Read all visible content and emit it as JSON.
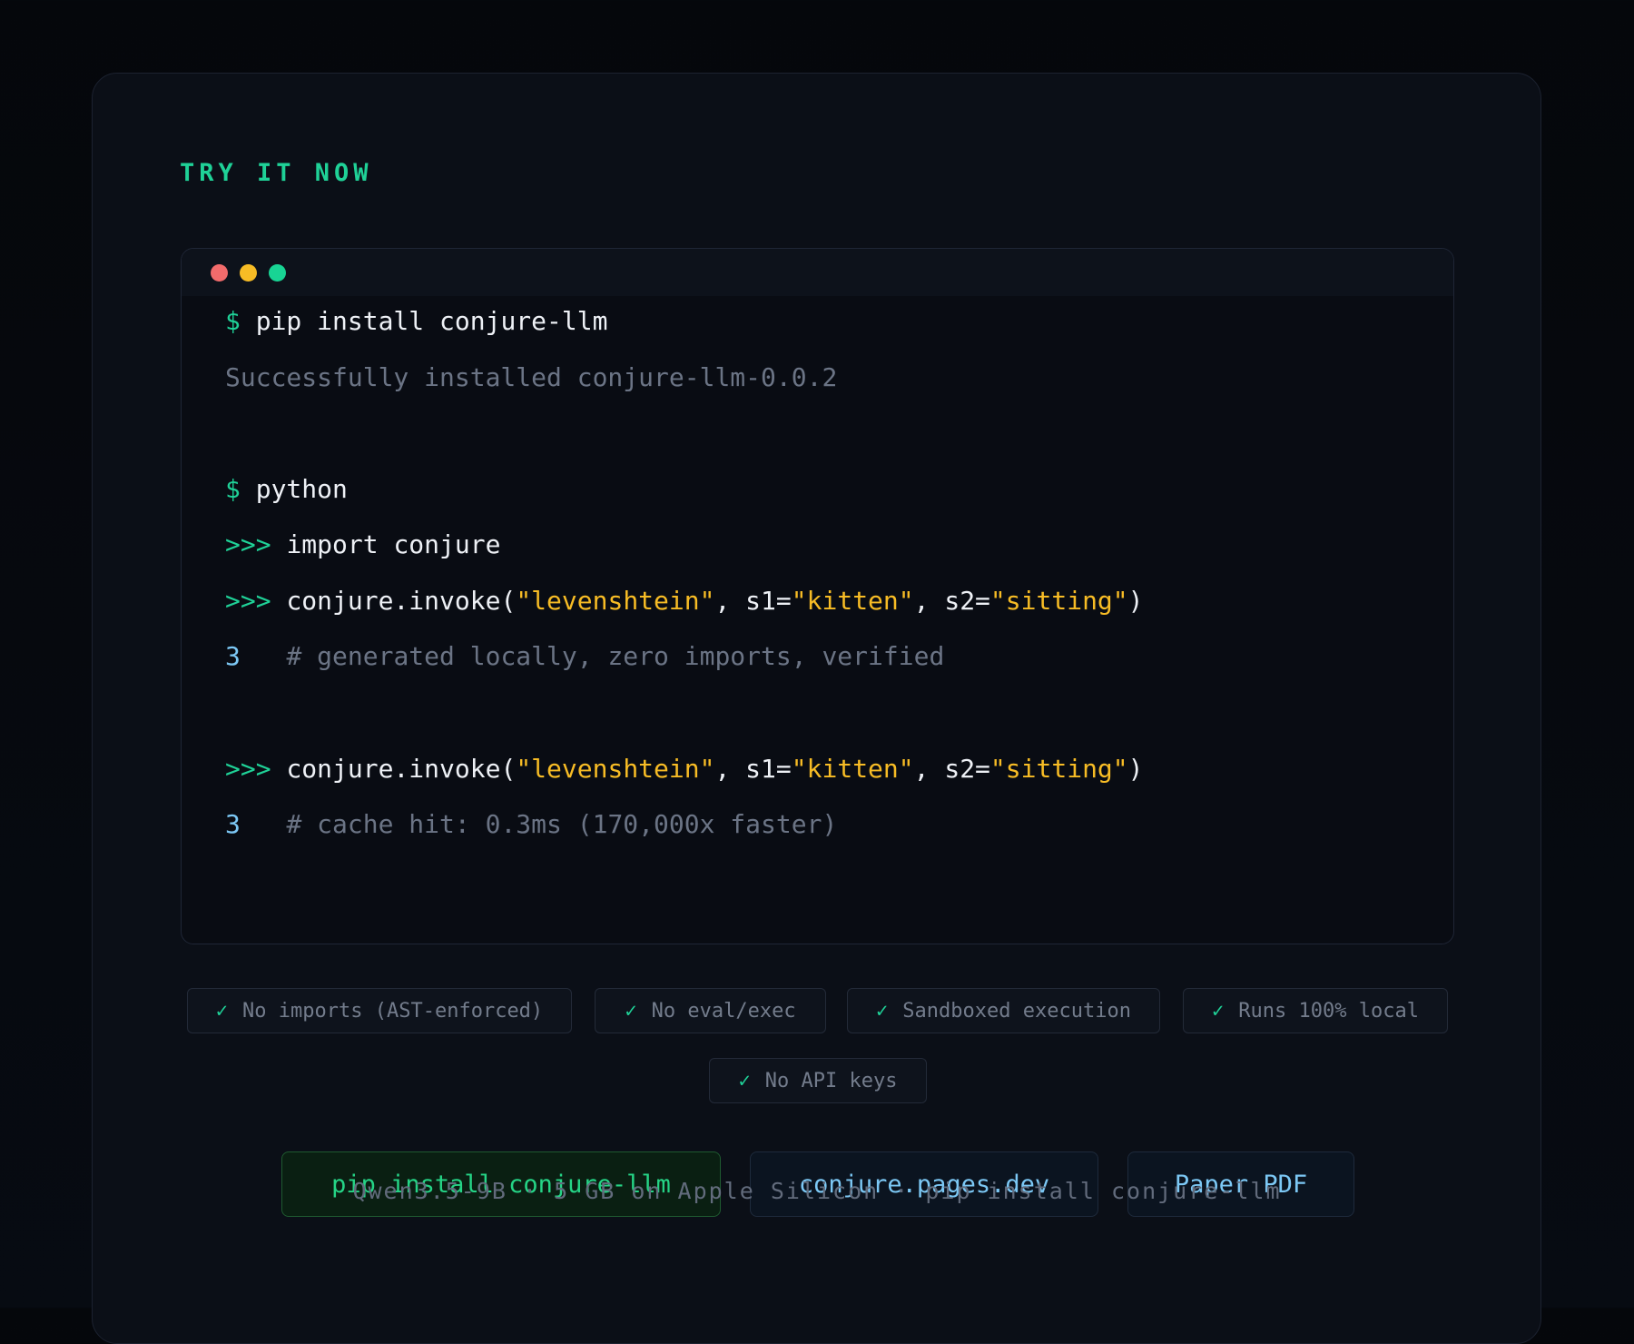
{
  "eyebrow": "TRY IT NOW",
  "terminal": {
    "lines": {
      "l1_prompt": "$",
      "l1_cmd": "pip install conjure-llm",
      "l2_out": "Successfully installed conjure-llm-0.0.2",
      "l3_prompt": "$",
      "l3_cmd": "python",
      "l4_prompt": ">>>",
      "l4_code": "import conjure",
      "l5_prompt": ">>>",
      "l5_pre": "conjure.invoke(",
      "l5_s1": "\"levenshtein\"",
      "l5_mid1": ", s1=",
      "l5_s2": "\"kitten\"",
      "l5_mid2": ", s2=",
      "l5_s3": "\"sitting\"",
      "l5_post": ")",
      "l6_num": "3",
      "l6_comment": "# generated locally, zero imports, verified",
      "l7_prompt": ">>>",
      "l7_pre": "conjure.invoke(",
      "l7_s1": "\"levenshtein\"",
      "l7_mid1": ", s1=",
      "l7_s2": "\"kitten\"",
      "l7_mid2": ", s2=",
      "l7_s3": "\"sitting\"",
      "l7_post": ")",
      "l8_num": "3",
      "l8_comment": "# cache hit: 0.3ms (170,000x faster)"
    }
  },
  "features": {
    "check": "✓",
    "items": [
      "No imports (AST-enforced)",
      "No eval/exec",
      "Sandboxed execution",
      "Runs 100% local",
      "No API keys"
    ]
  },
  "buttons": {
    "install": "pip install conjure-llm",
    "site": "conjure.pages.dev",
    "paper": "Paper PDF"
  },
  "footer": "Qwen3.5-9B · 5 GB on Apple Silicon · pip install conjure-llm",
  "colors": {
    "accent_green": "#1fd197",
    "string_yellow": "#f7bc25",
    "number_blue": "#7cc8f5",
    "muted_gray": "#6b7485",
    "dot_red": "#f26b6b",
    "dot_yellow": "#f7bc25",
    "dot_green": "#18d494"
  }
}
